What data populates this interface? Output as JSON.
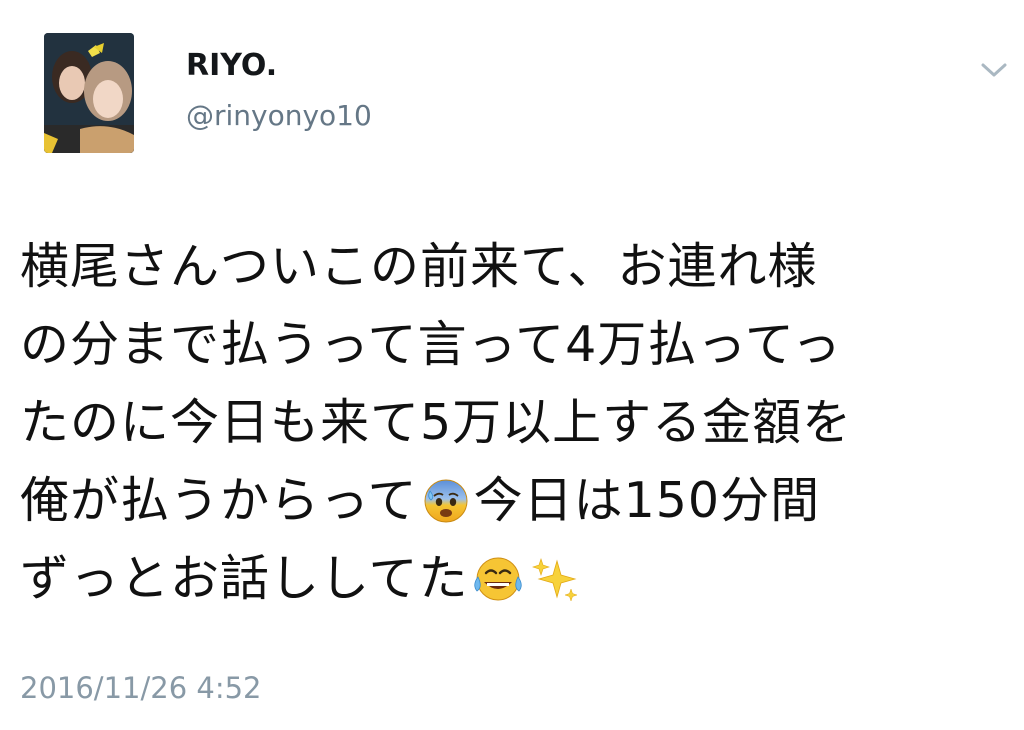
{
  "author": {
    "display_name": "RIYO.",
    "handle": "@rinyonyo10",
    "avatar": "profile-photo"
  },
  "tweet": {
    "lines": [
      "横尾さんついこの前来て、お連れ様",
      "の分まで払うって言って4万払ってっ",
      "たのに今日も来て5万以上する金額を",
      "俺が払うからって",
      "今日は150分間",
      "ずっとお話ししてた"
    ],
    "emojis": [
      "anxious-face-with-sweat-emoji",
      "face-with-tears-of-joy-emoji",
      "sparkles-emoji"
    ],
    "timestamp": "2016/11/26 4:52"
  },
  "controls": {
    "more_icon": "chevron-down-icon"
  },
  "colors": {
    "text": "#111111",
    "secondary": "#657786",
    "timestamp": "#8899a6",
    "chevron": "#aab8c2"
  }
}
